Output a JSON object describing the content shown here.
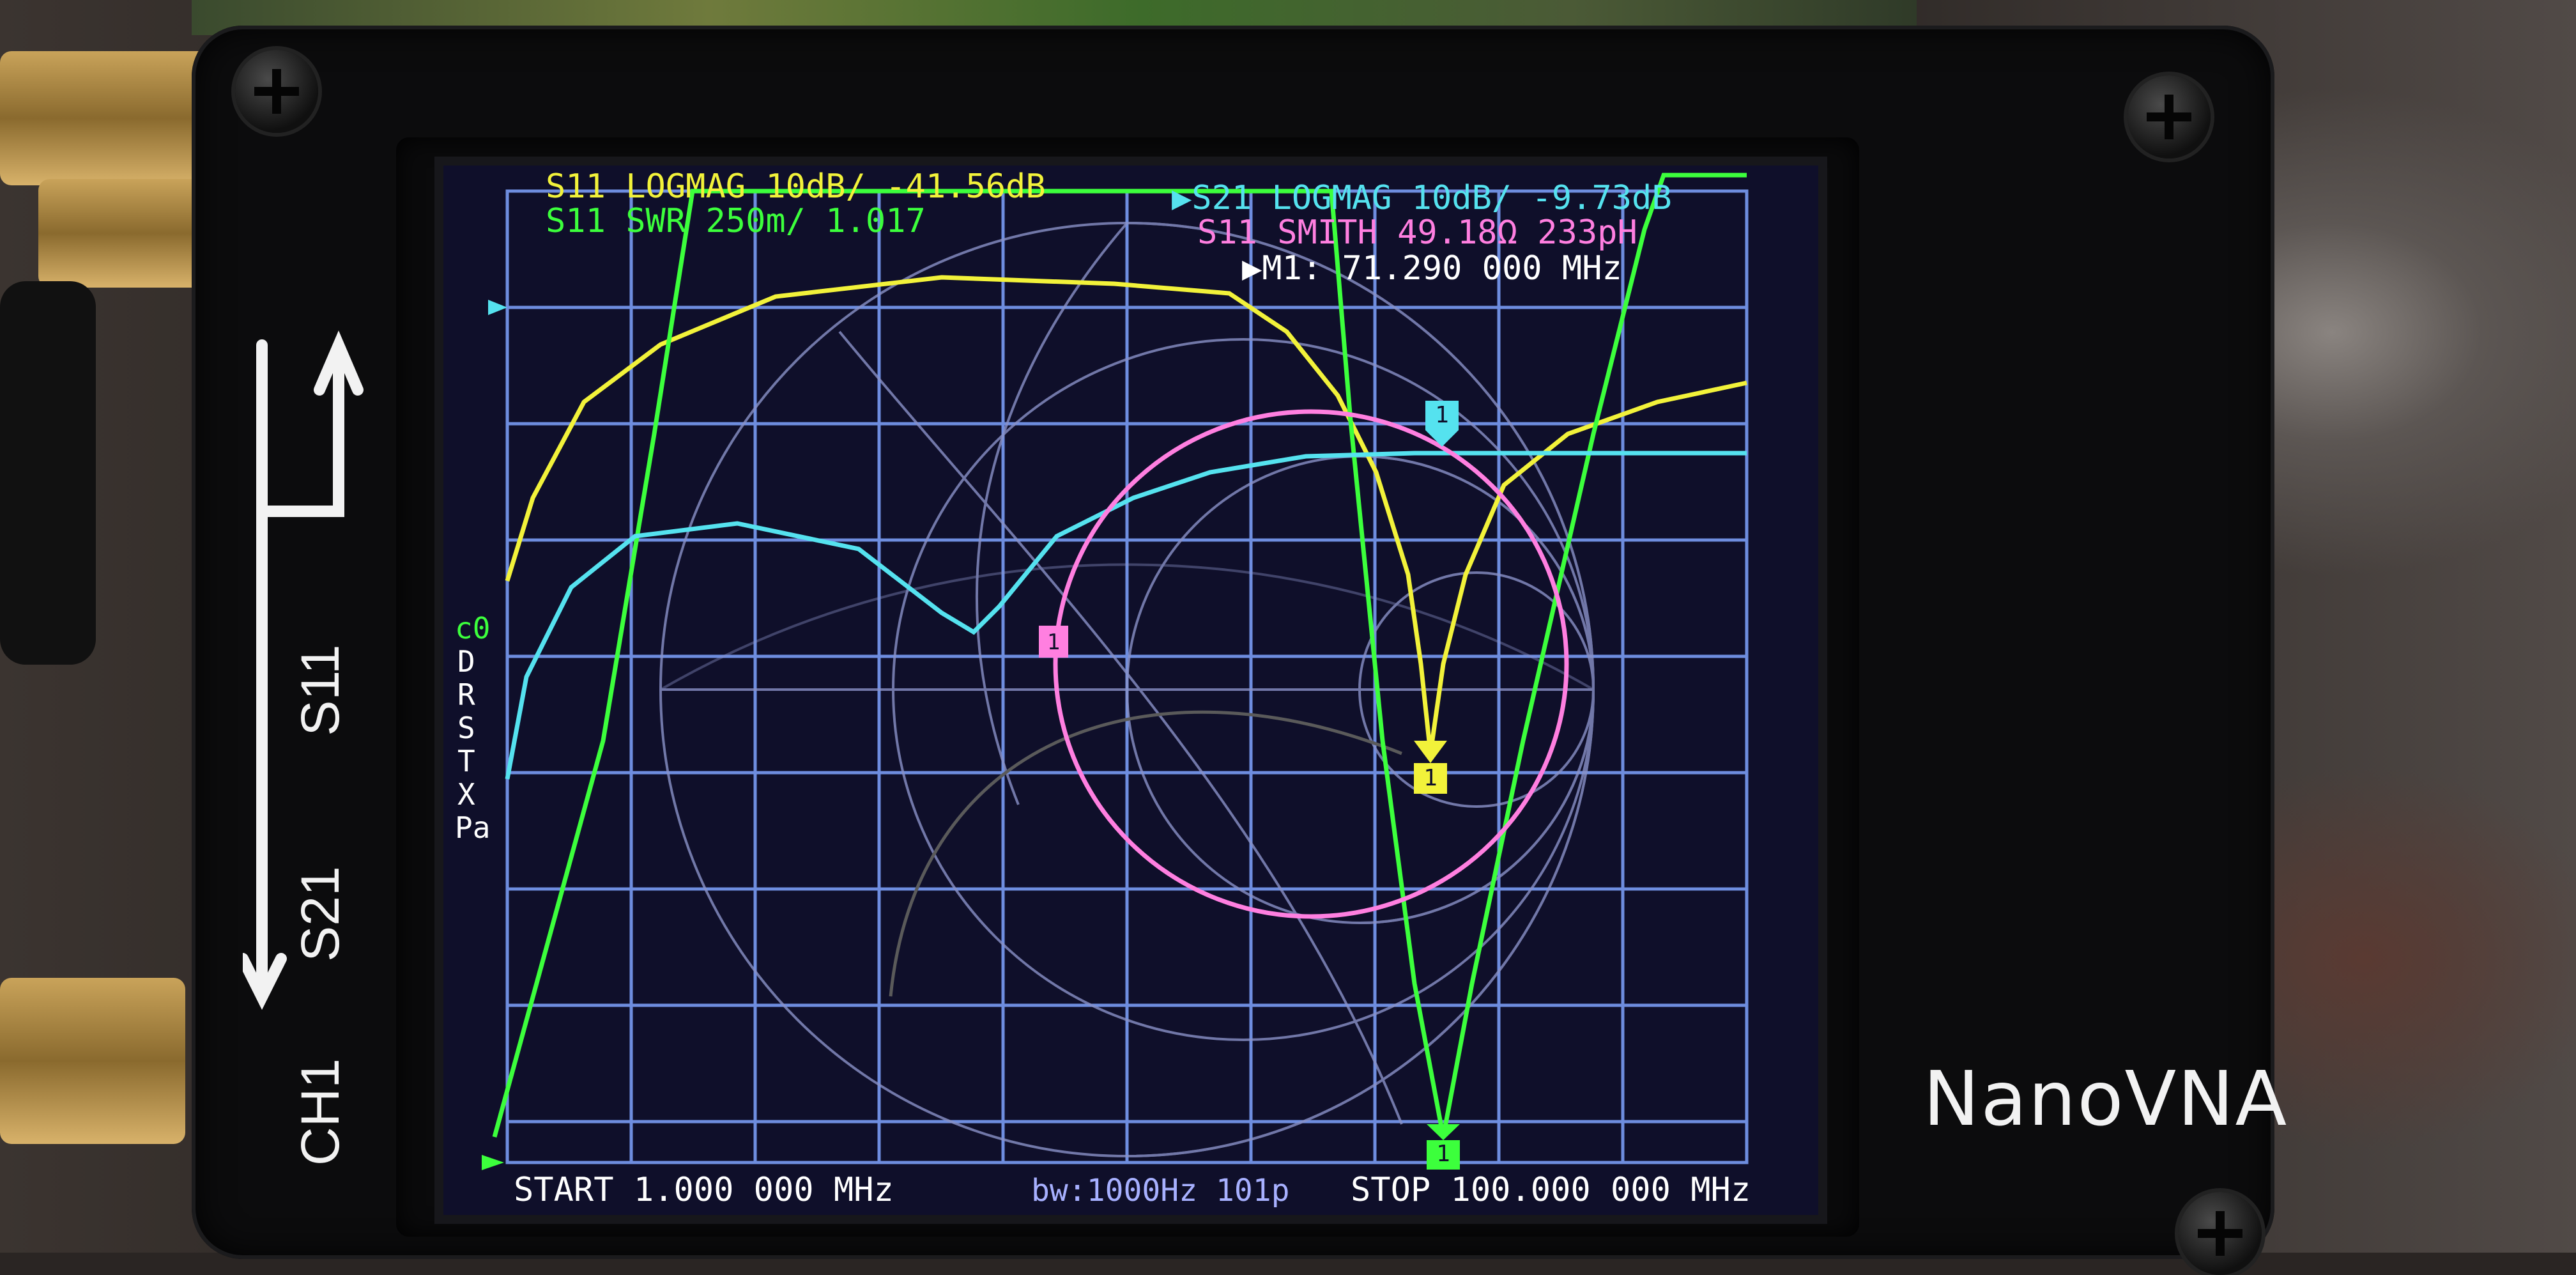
{
  "device": {
    "brand": "NanoVNA"
  },
  "panel_labels": {
    "port1": "S11",
    "port2": "S21",
    "channel": "CH1"
  },
  "header": {
    "trace1": {
      "label": "S11 LOGMAG 10dB/ -41.56dB",
      "color": "#f2f23a"
    },
    "trace2": {
      "label": "S11 SWR 250m/ 1.017",
      "color": "#3cff3c"
    },
    "trace3": {
      "label": "▶S21 LOGMAG 10dB/ -9.73dB",
      "color": "#55e2ef"
    },
    "trace4": {
      "label": "S11 SMITH 49.18Ω 233pH",
      "color": "#ff7fe0"
    },
    "marker": {
      "label": "▶M1: 71.290 000 MHz",
      "color": "#ffffff"
    }
  },
  "side_menu": [
    "c0",
    "D",
    "R",
    "S",
    "T",
    "X",
    "Pa"
  ],
  "footer": {
    "start": "START 1.000 000 MHz",
    "bw": "bw:1000Hz 101p",
    "stop": "STOP 100.000 000 MHz"
  },
  "marker_label": "1",
  "colors": {
    "grid": "#7fa3ff",
    "smith": "#8a92c8",
    "screen_bg": "#0f0f2a",
    "s11_logmag": "#f2f23a",
    "swr": "#3cff3c",
    "s21_logmag": "#55e2ef",
    "s11_smith": "#ff7fe0"
  }
}
